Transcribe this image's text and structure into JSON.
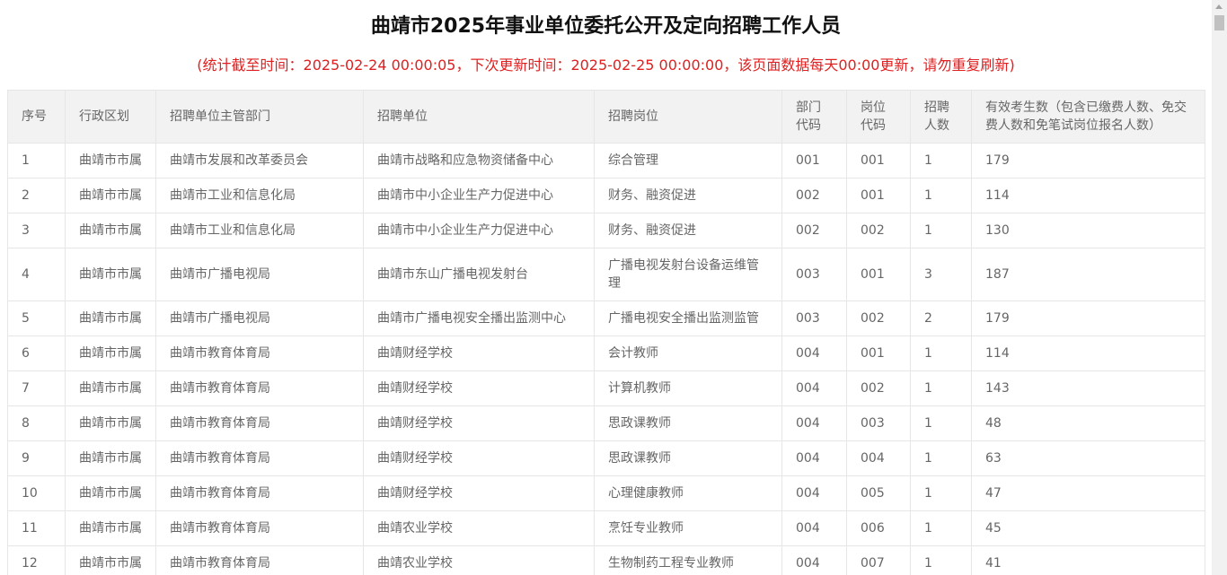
{
  "page": {
    "title": "曲靖市2025年事业单位委托公开及定向招聘工作人员",
    "notice": "(统计截至时间：2025-02-24 00:00:05，下次更新时间：2025-02-25 00:00:00，该页面数据每天00:00更新，请勿重复刷新)"
  },
  "table": {
    "headers": [
      "序号",
      "行政区划",
      "招聘单位主管部门",
      "招聘单位",
      "招聘岗位",
      "部门代码",
      "岗位代码",
      "招聘人数",
      "有效考生数（包含已缴费人数、免交费人数和免笔试岗位报名人数）"
    ],
    "rows": [
      [
        "1",
        "曲靖市市属",
        "曲靖市发展和改革委员会",
        "曲靖市战略和应急物资储备中心",
        "综合管理",
        "001",
        "001",
        "1",
        "179"
      ],
      [
        "2",
        "曲靖市市属",
        "曲靖市工业和信息化局",
        "曲靖市中小企业生产力促进中心",
        "财务、融资促进",
        "002",
        "001",
        "1",
        "114"
      ],
      [
        "3",
        "曲靖市市属",
        "曲靖市工业和信息化局",
        "曲靖市中小企业生产力促进中心",
        "财务、融资促进",
        "002",
        "002",
        "1",
        "130"
      ],
      [
        "4",
        "曲靖市市属",
        "曲靖市广播电视局",
        "曲靖市东山广播电视发射台",
        "广播电视发射台设备运维管理",
        "003",
        "001",
        "3",
        "187"
      ],
      [
        "5",
        "曲靖市市属",
        "曲靖市广播电视局",
        "曲靖市广播电视安全播出监测中心",
        "广播电视安全播出监测监管",
        "003",
        "002",
        "2",
        "179"
      ],
      [
        "6",
        "曲靖市市属",
        "曲靖市教育体育局",
        "曲靖财经学校",
        "会计教师",
        "004",
        "001",
        "1",
        "114"
      ],
      [
        "7",
        "曲靖市市属",
        "曲靖市教育体育局",
        "曲靖财经学校",
        "计算机教师",
        "004",
        "002",
        "1",
        "143"
      ],
      [
        "8",
        "曲靖市市属",
        "曲靖市教育体育局",
        "曲靖财经学校",
        "思政课教师",
        "004",
        "003",
        "1",
        "48"
      ],
      [
        "9",
        "曲靖市市属",
        "曲靖市教育体育局",
        "曲靖财经学校",
        "思政课教师",
        "004",
        "004",
        "1",
        "63"
      ],
      [
        "10",
        "曲靖市市属",
        "曲靖市教育体育局",
        "曲靖财经学校",
        "心理健康教师",
        "004",
        "005",
        "1",
        "47"
      ],
      [
        "11",
        "曲靖市市属",
        "曲靖市教育体育局",
        "曲靖农业学校",
        "烹饪专业教师",
        "004",
        "006",
        "1",
        "45"
      ],
      [
        "12",
        "曲靖市市属",
        "曲靖市教育体育局",
        "曲靖农业学校",
        "生物制药工程专业教师",
        "004",
        "007",
        "1",
        "41"
      ]
    ]
  }
}
